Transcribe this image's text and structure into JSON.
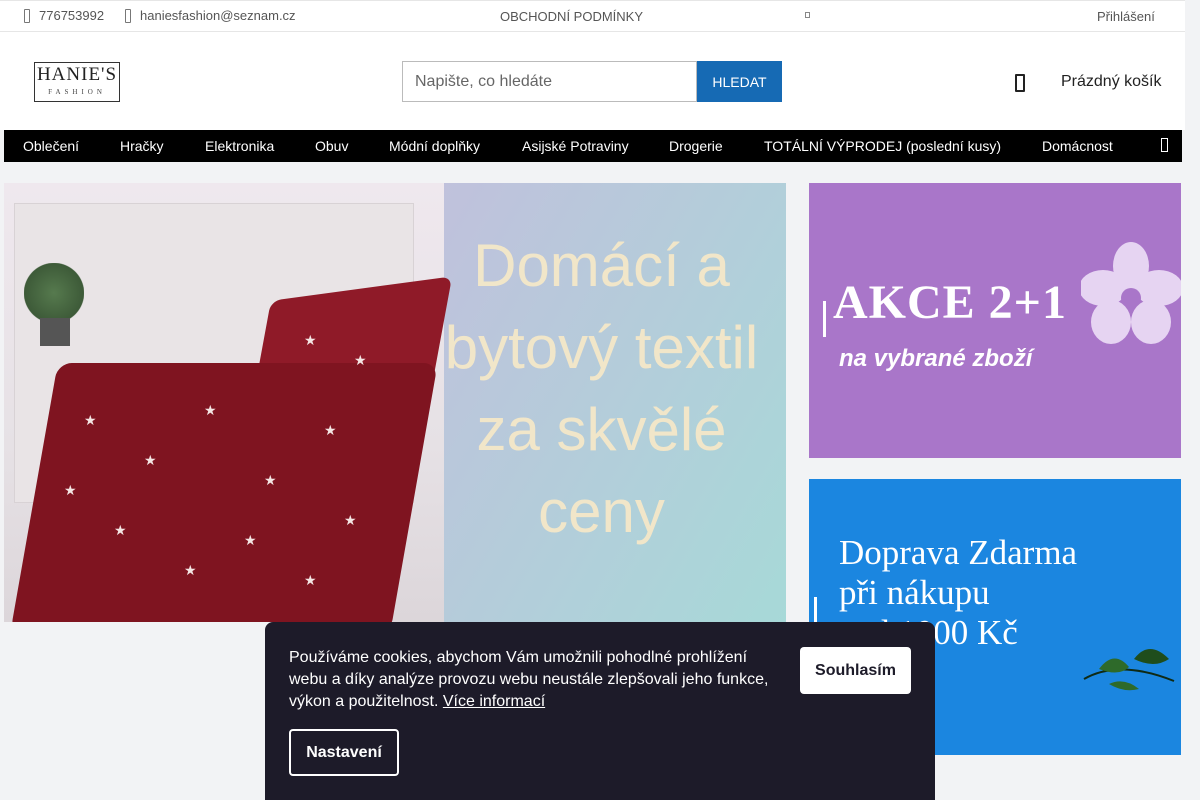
{
  "topbar": {
    "phone": "776753992",
    "email": "haniesfashion@seznam.cz",
    "terms": "OBCHODNÍ PODMÍNKY",
    "login": "Přihlášení"
  },
  "header": {
    "logo_line1": "HANIE'S",
    "logo_line2": "FASHION",
    "search_placeholder": "Napište, co hledáte",
    "search_button": "HLEDAT",
    "cart_label": "Prázdný košík"
  },
  "nav": {
    "items": [
      {
        "label": "Oblečení"
      },
      {
        "label": "Hračky"
      },
      {
        "label": "Elektronika"
      },
      {
        "label": "Obuv"
      },
      {
        "label": "Módní doplňky"
      },
      {
        "label": "Asijské Potraviny"
      },
      {
        "label": "Drogerie"
      },
      {
        "label": "TOTÁLNÍ VÝPRODEJ (poslední kusy)"
      },
      {
        "label": "Domácnost"
      }
    ]
  },
  "banners": {
    "main_text": "Domácí a bytový textil za skvělé ceny",
    "akce_title": "AKCE 2+1",
    "akce_sub": "na vybrané zboží",
    "doprava_line1": "Doprava Zdarma",
    "doprava_line2": "při nákupu",
    "doprava_line3": "nad 1000 Kč"
  },
  "cookie": {
    "message": "Používáme cookies, abychom Vám umožnili pohodlné prohlížení webu a díky analýze provozu webu neustále zlepšovali jeho funkce, výkon a použitelnost.",
    "more_link": "Více informací",
    "agree_button": "Souhlasím",
    "settings_button": "Nastavení"
  },
  "colors": {
    "accent": "#166ab4",
    "nav_bg": "#000000",
    "akce_bg": "#a976c9",
    "doprava_bg": "#1b86e0",
    "cookie_bg": "#1d1b29"
  },
  "icons": [
    "phone-icon",
    "mail-icon",
    "lock-icon",
    "cart-icon",
    "chevron-right-icon",
    "flower-icon",
    "bird-icon"
  ]
}
